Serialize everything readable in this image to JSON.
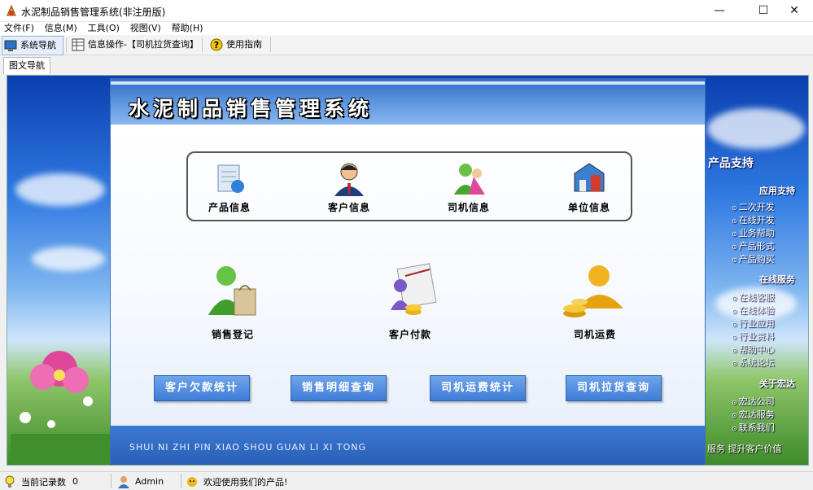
{
  "window": {
    "title": "水泥制品销售管理系统(非注册版)",
    "minimize": "—",
    "maximize": "☐",
    "close": "✕"
  },
  "menu": [
    "文件(F)",
    "信息(M)",
    "工具(O)",
    "视图(V)",
    "帮助(H)"
  ],
  "toolbar": {
    "nav_label": "系统导航",
    "info_label": "信息操作-【司机拉货查询】",
    "guide_label": "使用指南"
  },
  "tab": {
    "label": "图文导航"
  },
  "panel": {
    "title": "水泥制品销售管理系统",
    "top_items": [
      "产品信息",
      "客户信息",
      "司机信息",
      "单位信息"
    ],
    "mid_items": [
      "销售登记",
      "客户付款",
      "司机运费"
    ],
    "buttons": [
      "客户欠款统计",
      "销售明细查询",
      "司机运费统计",
      "司机拉货查询"
    ],
    "footer": "SHUI NI ZHI PIN XIAO SHOU GUAN LI XI TONG"
  },
  "side": {
    "heading": "产品支持",
    "sections": [
      {
        "title": "应用支持",
        "links": [
          "二次开发",
          "在线开发",
          "业务帮助",
          "产品形式",
          "产品购买"
        ]
      },
      {
        "title": "在线服务",
        "links": [
          "在线客服",
          "在线体验",
          "行业应用",
          "行业资料",
          "帮助中心",
          "系统论坛"
        ]
      },
      {
        "title": "关于宏达",
        "links": [
          "宏达公司",
          "宏达服务",
          "联系我们"
        ]
      }
    ],
    "footer": "服务 提升客户价值"
  },
  "status": {
    "records_label": "当前记录数",
    "records_value": "0",
    "user": "Admin",
    "message": "欢迎使用我们的产品!"
  },
  "colors": {
    "panel_head": "#3f7cd6",
    "button": "#4a86dc",
    "accent_text": "#ffffff"
  }
}
